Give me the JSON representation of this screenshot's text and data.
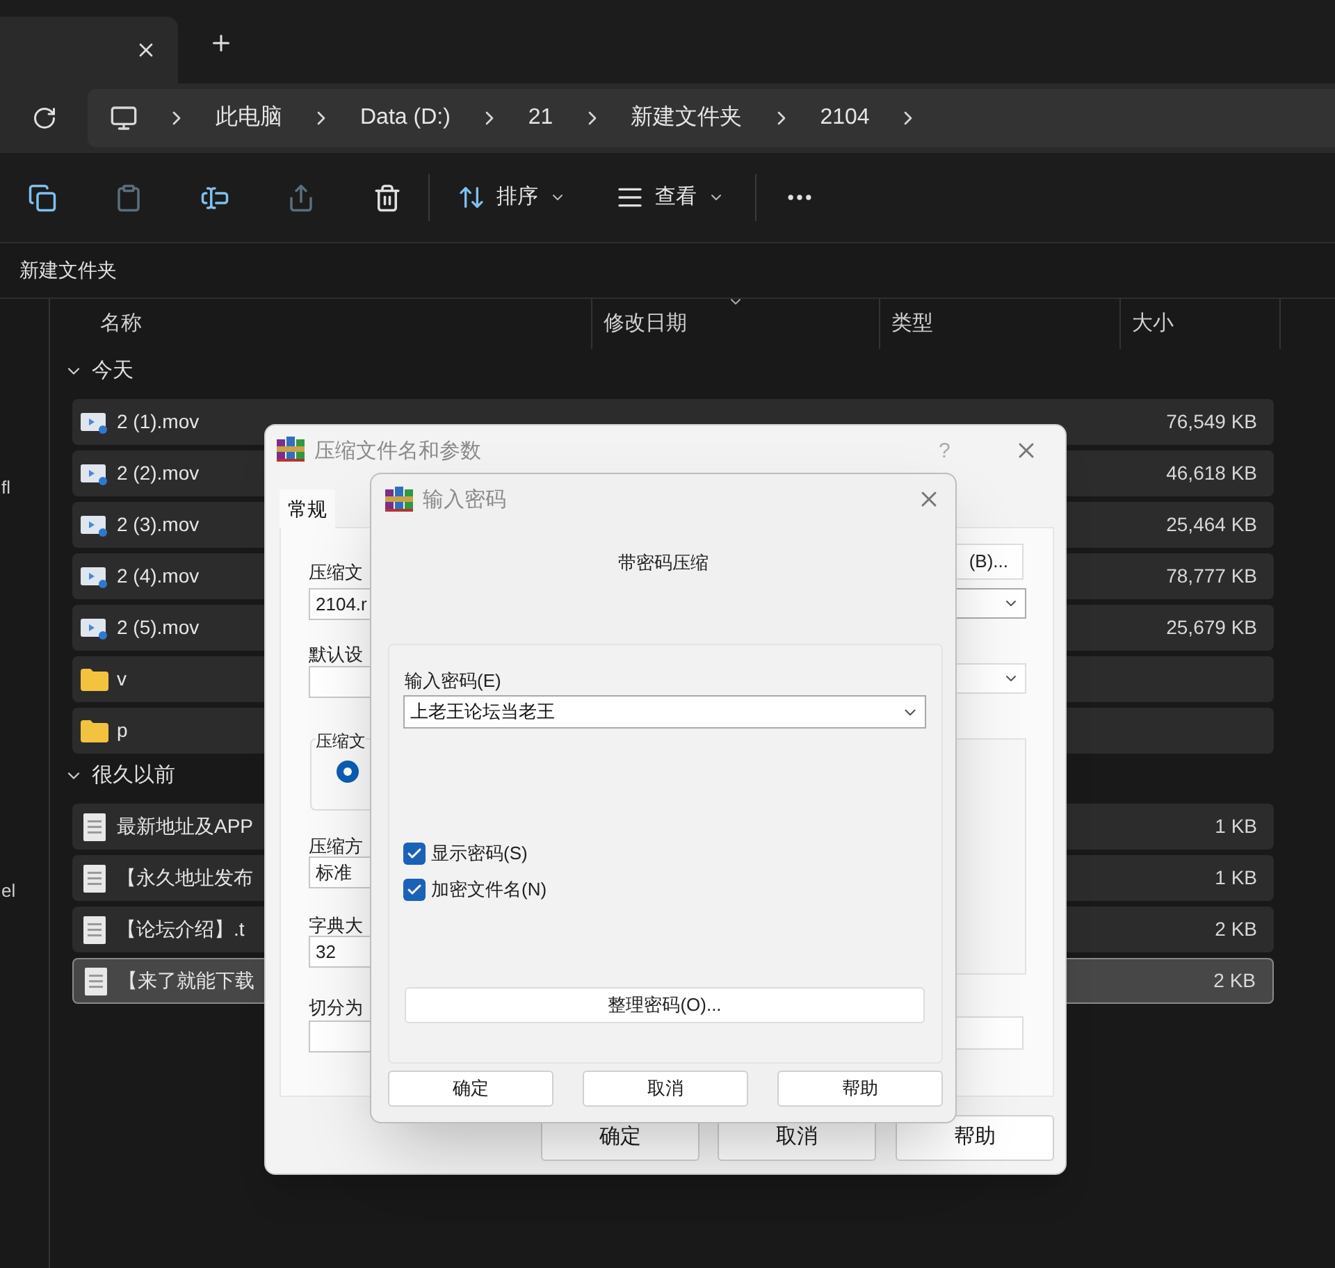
{
  "breadcrumb": [
    "此电脑",
    "Data (D:)",
    "21",
    "新建文件夹",
    "2104"
  ],
  "toolbar": [
    {
      "kind": "copy",
      "disabled": false
    },
    {
      "kind": "paste",
      "disabled": true
    },
    {
      "kind": "rename",
      "disabled": false
    },
    {
      "kind": "share",
      "disabled": true
    },
    {
      "kind": "delete",
      "disabled": false
    }
  ],
  "menus": [
    {
      "kind": "sort",
      "label": "排序"
    },
    {
      "kind": "view",
      "label": "查看"
    }
  ],
  "location_title": "新建文件夹",
  "sidebar_fragments": [
    "fl",
    "el"
  ],
  "columns": [
    "名称",
    "修改日期",
    "类型",
    "大小"
  ],
  "groups": [
    {
      "label": "今天",
      "expanded": true,
      "rows": [
        {
          "kind": "video",
          "name": "2 (1).mov",
          "size": "76,549 KB",
          "selected": false
        },
        {
          "kind": "video",
          "name": "2 (2).mov",
          "size": "46,618 KB",
          "selected": false
        },
        {
          "kind": "video",
          "name": "2 (3).mov",
          "size": "25,464 KB",
          "selected": false
        },
        {
          "kind": "video",
          "name": "2 (4).mov",
          "size": "78,777 KB",
          "selected": false
        },
        {
          "kind": "video",
          "name": "2 (5).mov",
          "size": "25,679 KB",
          "selected": false
        },
        {
          "kind": "folder",
          "name": "v",
          "selected": false
        },
        {
          "kind": "folder",
          "name": "p",
          "selected": false
        }
      ]
    },
    {
      "label": "很久以前",
      "expanded": true,
      "rows": [
        {
          "kind": "text",
          "name": "最新地址及APP",
          "size": "1 KB",
          "selected": false
        },
        {
          "kind": "text",
          "name": "【永久地址发布",
          "size": "1 KB",
          "selected": false
        },
        {
          "kind": "text",
          "name": "【论坛介绍】.t",
          "size": "2 KB",
          "selected": false
        },
        {
          "kind": "text",
          "name": "【来了就能下载",
          "size": "2 KB",
          "selected": true
        }
      ]
    }
  ],
  "archive_dialog": {
    "title": "压缩文件名和参数",
    "help": "?",
    "tab": {
      "label": "常规",
      "selected": true
    },
    "fields": [
      {
        "label": "压缩文",
        "value": "2104.r"
      },
      {
        "label": "默认设"
      },
      {
        "label": "压缩方",
        "value": "标准"
      },
      {
        "label": "字典大",
        "value": "32"
      },
      {
        "label": "切分为"
      }
    ],
    "group_label": "压缩文",
    "radio_selected": true,
    "browse_button": "(B)...",
    "buttons": [
      "确定",
      "取消",
      "帮助"
    ]
  },
  "password_dialog": {
    "title": "输入密码",
    "heading": "带密码压缩",
    "password_label": "输入密码(E)",
    "password_value": "上老王论坛当老王",
    "options": [
      {
        "label": "显示密码(S)",
        "checked": true
      },
      {
        "label": "加密文件名(N)",
        "checked": true
      }
    ],
    "organize_button": "整理密码(O)...",
    "buttons": [
      "确定",
      "取消",
      "帮助"
    ]
  }
}
